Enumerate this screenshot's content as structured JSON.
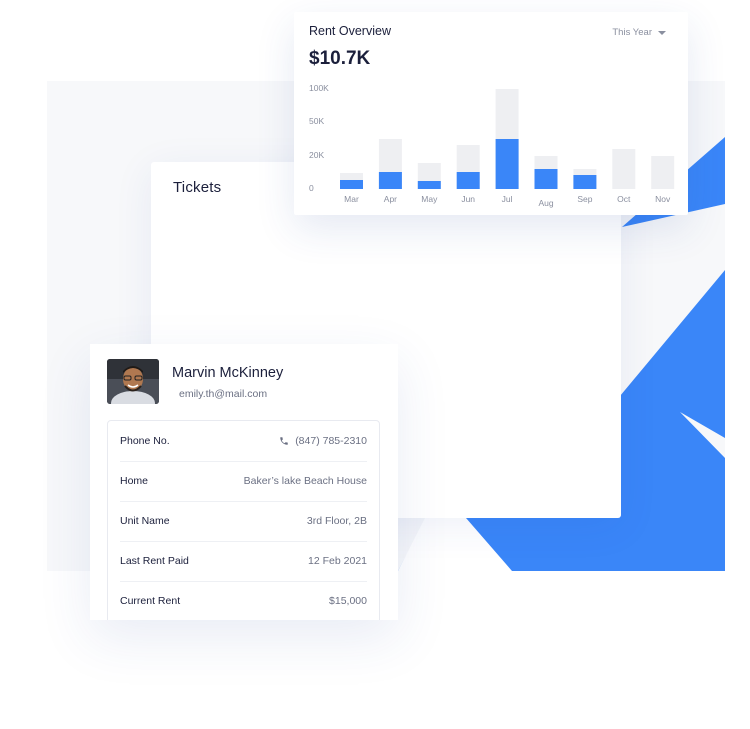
{
  "tickets": {
    "title": "Tickets"
  },
  "rent_overview": {
    "title": "Rent Overview",
    "period": "This Year",
    "amount": "$10.7K"
  },
  "chart_data": {
    "type": "bar",
    "categories": [
      "Mar",
      "Apr",
      "May",
      "Jun",
      "Jul",
      "Aug",
      "Sep",
      "Oct",
      "Nov"
    ],
    "y_ticks": [
      "100K",
      "50K",
      "20K",
      "0"
    ],
    "series": [
      {
        "values": [
          9,
          17,
          8,
          17,
          50,
          20,
          14,
          0,
          0
        ],
        "color": "#3a86f8"
      },
      {
        "values": [
          16,
          50,
          26,
          44,
          100,
          33,
          20,
          40,
          33
        ],
        "color": "#eeeff2"
      }
    ],
    "ylim": [
      0,
      100
    ]
  },
  "profile": {
    "name": "Marvin McKinney",
    "email": "emily.th@mail.com",
    "rows": [
      {
        "label": "Phone No.",
        "value": "(847) 785-2310"
      },
      {
        "label": "Home",
        "value": "Baker’s lake Beach House"
      },
      {
        "label": "Unit Name",
        "value": "3rd Floor, 2B"
      },
      {
        "label": "Last Rent Paid",
        "value": "12 Feb 2021"
      },
      {
        "label": "Current Rent",
        "value": "$15,000"
      }
    ]
  },
  "colors": {
    "accent": "#3a86f8",
    "bar_background": "#eeeff2",
    "text_dark": "#1b1f3b",
    "text_muted": "#6b7083"
  }
}
